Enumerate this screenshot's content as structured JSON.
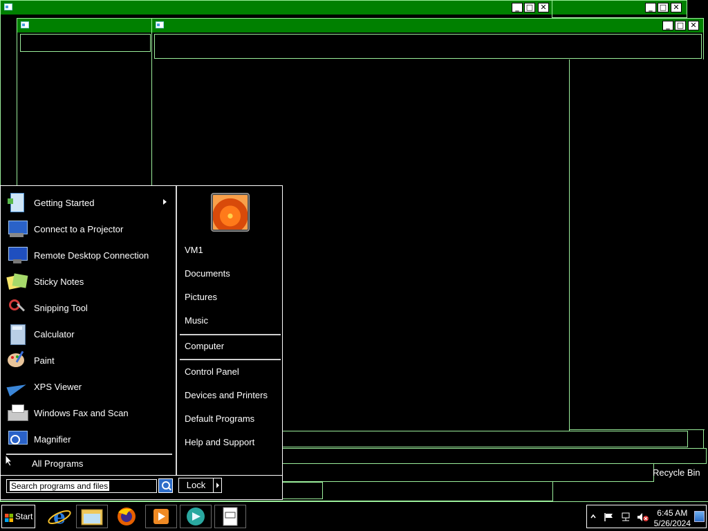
{
  "start_menu": {
    "programs": [
      {
        "label": "Getting Started",
        "icon": "getting-started-icon",
        "has_submenu": true
      },
      {
        "label": "Connect to a Projector",
        "icon": "projector-icon"
      },
      {
        "label": "Remote Desktop Connection",
        "icon": "remote-desktop-icon"
      },
      {
        "label": "Sticky Notes",
        "icon": "sticky-notes-icon"
      },
      {
        "label": "Snipping Tool",
        "icon": "snipping-tool-icon"
      },
      {
        "label": "Calculator",
        "icon": "calculator-icon"
      },
      {
        "label": "Paint",
        "icon": "paint-icon"
      },
      {
        "label": "XPS Viewer",
        "icon": "xps-viewer-icon"
      },
      {
        "label": "Windows Fax and Scan",
        "icon": "fax-scan-icon"
      },
      {
        "label": "Magnifier",
        "icon": "magnifier-icon"
      }
    ],
    "all_programs": "All Programs",
    "search_placeholder": "Search programs and files",
    "right_links": [
      {
        "label": "VM1"
      },
      {
        "label": "Documents"
      },
      {
        "label": "Pictures"
      },
      {
        "label": "Music"
      },
      {
        "label": "Computer"
      },
      {
        "label": "Control Panel"
      },
      {
        "label": "Devices and Printers"
      },
      {
        "label": "Default Programs"
      },
      {
        "label": "Help and Support"
      }
    ],
    "lock_label": "Lock"
  },
  "taskbar": {
    "start_label": "Start",
    "apps": [
      "internet-explorer-icon",
      "windows-explorer-icon",
      "firefox-icon",
      "media-player-icon",
      "media-center-icon",
      "notepad-icon"
    ],
    "clock_time": "6:45 AM",
    "clock_date": "5/26/2024"
  },
  "desktop": {
    "recycle_bin_label": "Recycle Bin"
  },
  "colors": {
    "titlebar": "#008000",
    "border": "#9cf09c",
    "background": "#000000"
  }
}
